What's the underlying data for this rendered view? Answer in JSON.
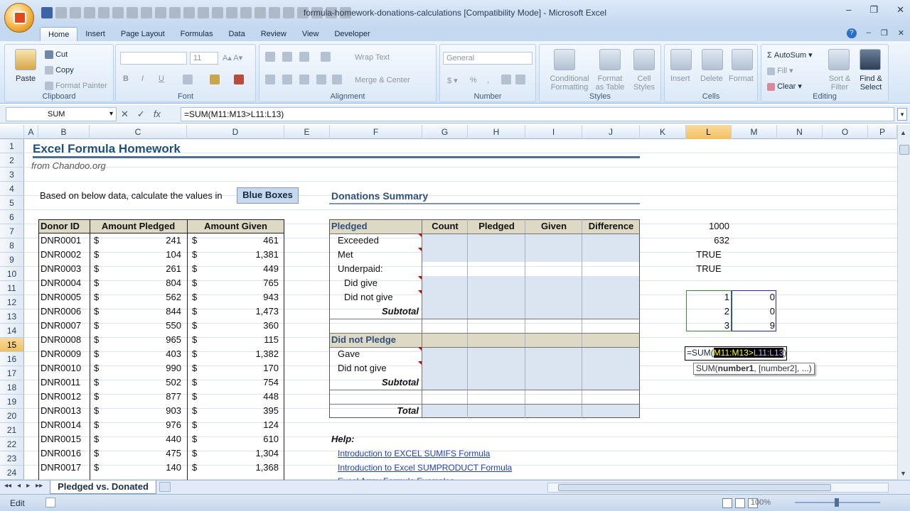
{
  "window": {
    "title": "formula-homework-donations-calculations  [Compatibility Mode] - Microsoft Excel"
  },
  "tabs": [
    "Home",
    "Insert",
    "Page Layout",
    "Formulas",
    "Data",
    "Review",
    "View",
    "Developer"
  ],
  "ribbon": {
    "clipboard": {
      "label": "Clipboard",
      "paste": "Paste",
      "cut": "Cut",
      "copy": "Copy",
      "format_painter": "Format Painter"
    },
    "font": {
      "label": "Font",
      "size": "11"
    },
    "alignment": {
      "label": "Alignment",
      "wrap": "Wrap Text",
      "merge": "Merge & Center"
    },
    "number": {
      "label": "Number",
      "format": "General"
    },
    "styles": {
      "label": "Styles",
      "cond1": "Conditional",
      "cond2": "Formatting",
      "fmt1": "Format",
      "fmt2": "as Table",
      "cell1": "Cell",
      "cell2": "Styles"
    },
    "cells": {
      "label": "Cells",
      "insert": "Insert",
      "delete": "Delete",
      "format": "Format"
    },
    "editing": {
      "label": "Editing",
      "autosum": "AutoSum",
      "fill": "Fill",
      "clear": "Clear",
      "sort1": "Sort &",
      "sort2": "Filter",
      "find1": "Find &",
      "find2": "Select"
    }
  },
  "formula_bar": {
    "name_box": "SUM",
    "formula": "=SUM(M11:M13>L11:L13)"
  },
  "columns": [
    "A",
    "B",
    "C",
    "D",
    "E",
    "F",
    "G",
    "H",
    "I",
    "J",
    "K",
    "L",
    "M",
    "N",
    "O",
    "P"
  ],
  "rows": [
    "1",
    "2",
    "3",
    "4",
    "5",
    "6",
    "7",
    "8",
    "9",
    "10",
    "11",
    "12",
    "13",
    "14",
    "15",
    "16",
    "17",
    "18",
    "19",
    "20",
    "21",
    "22",
    "23",
    "24"
  ],
  "sheet": {
    "title": "Excel Formula Homework",
    "subtitle": "from Chandoo.org",
    "instruction": "Based on below data, calculate the values in",
    "blue_boxes": "Blue Boxes",
    "summary_title": "Donations Summary",
    "donor_headers": [
      "Donor ID",
      "Amount Pledged",
      "Amount Given"
    ],
    "currency": "$",
    "donors": [
      [
        "DNR0001",
        "241",
        "461"
      ],
      [
        "DNR0002",
        "104",
        "1,381"
      ],
      [
        "DNR0003",
        "261",
        "449"
      ],
      [
        "DNR0004",
        "804",
        "765"
      ],
      [
        "DNR0005",
        "562",
        "943"
      ],
      [
        "DNR0006",
        "844",
        "1,473"
      ],
      [
        "DNR0007",
        "550",
        "360"
      ],
      [
        "DNR0008",
        "965",
        "115"
      ],
      [
        "DNR0009",
        "403",
        "1,382"
      ],
      [
        "DNR0010",
        "990",
        "170"
      ],
      [
        "DNR0011",
        "502",
        "754"
      ],
      [
        "DNR0012",
        "877",
        "448"
      ],
      [
        "DNR0013",
        "903",
        "395"
      ],
      [
        "DNR0014",
        "976",
        "124"
      ],
      [
        "DNR0015",
        "440",
        "610"
      ],
      [
        "DNR0016",
        "475",
        "1,304"
      ],
      [
        "DNR0017",
        "140",
        "1,368"
      ]
    ],
    "summary_headers": [
      "Pledged",
      "Count",
      "Pledged",
      "Given",
      "Difference"
    ],
    "summary_rows": [
      "Exceeded",
      "Met",
      "Underpaid:",
      "Did give",
      "Did not give",
      "Subtotal"
    ],
    "did_not_pledge": "Did not Pledge",
    "dnp_rows": [
      "Gave",
      "Did not give",
      "Subtotal"
    ],
    "total": "Total",
    "help_label": "Help:",
    "help_links": [
      "Introduction to EXCEL SUMIFS Formula",
      "Introduction to Excel SUMPRODUCT Formula",
      "Excel Array Formula Examples"
    ],
    "side_values": [
      "1000",
      "632",
      "TRUE",
      "TRUE"
    ],
    "l_values": [
      "1",
      "2",
      "3"
    ],
    "m_values": [
      "0",
      "0",
      "9"
    ],
    "edit_prefix": "=SUM(",
    "edit_ref1": "M11:M13",
    "edit_gt": ">",
    "edit_ref2": "L11:L13",
    "edit_suffix": ")",
    "tooltip_fn": "SUM(",
    "tooltip_arg": "number1",
    "tooltip_rest": ", [number2], ...)"
  },
  "sheet_tab": "Pledged vs. Donated",
  "status": {
    "mode": "Edit",
    "zoom": "100%"
  }
}
